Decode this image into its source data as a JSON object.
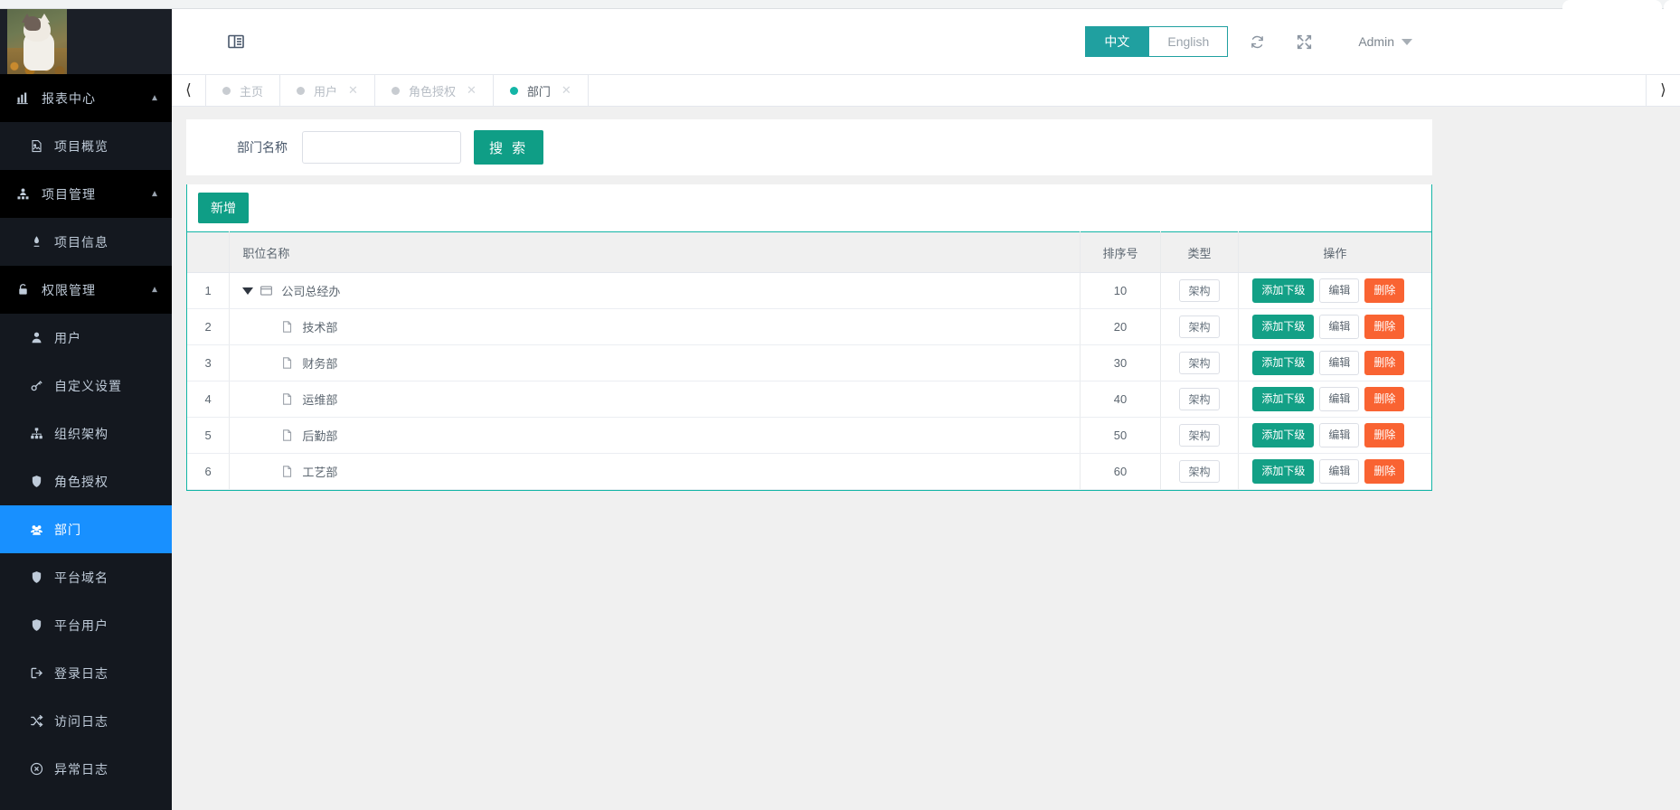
{
  "header": {
    "hamburger_icon": "collapse-menu-icon",
    "lang_active": "中文",
    "lang_inactive": "English",
    "refresh_icon": "refresh-icon",
    "fullscreen_icon": "fullscreen-icon",
    "user_name": "Admin",
    "accent_teal": "#20a0a0"
  },
  "sidebar": {
    "avatar_name": "cat-avatar-photo",
    "groups": [
      {
        "label": "报表中心",
        "icon": "bar-chart-icon",
        "expanded": true,
        "items": [
          {
            "label": "项目概览",
            "icon": "image-file-icon",
            "active": false
          }
        ]
      },
      {
        "label": "项目管理",
        "icon": "project-user-icon",
        "expanded": true,
        "items": [
          {
            "label": "项目信息",
            "icon": "pen-icon",
            "active": false
          }
        ]
      },
      {
        "label": "权限管理",
        "icon": "lock-icon",
        "expanded": true,
        "items": [
          {
            "label": "用户",
            "icon": "user-icon",
            "active": false
          },
          {
            "label": "自定义设置",
            "icon": "key-icon",
            "active": false
          },
          {
            "label": "组织架构",
            "icon": "sitemap-icon",
            "active": false
          },
          {
            "label": "角色授权",
            "icon": "shield-icon",
            "active": false
          },
          {
            "label": "部门",
            "icon": "users-group-icon",
            "active": true
          },
          {
            "label": "平台域名",
            "icon": "shield-icon",
            "active": false
          },
          {
            "label": "平台用户",
            "icon": "shield-icon",
            "active": false
          },
          {
            "label": "登录日志",
            "icon": "sign-in-icon",
            "active": false
          },
          {
            "label": "访问日志",
            "icon": "shuffle-icon",
            "active": false
          },
          {
            "label": "异常日志",
            "icon": "error-circle-icon",
            "active": false
          }
        ]
      }
    ],
    "active_color": "#1890ff",
    "bg_color": "#14181f"
  },
  "tabs": {
    "prev_icon": "chevron-left-icon",
    "next_icon": "chevron-right-icon",
    "items": [
      {
        "label": "主页",
        "closable": false,
        "active": false
      },
      {
        "label": "用户",
        "closable": true,
        "active": false
      },
      {
        "label": "角色授权",
        "closable": true,
        "active": false
      },
      {
        "label": "部门",
        "closable": true,
        "active": true
      }
    ]
  },
  "search": {
    "label": "部门名称",
    "value": "",
    "placeholder": "",
    "button": "搜 索"
  },
  "toolbar": {
    "add_label": "新增"
  },
  "table": {
    "columns": [
      {
        "key": "index",
        "label": ""
      },
      {
        "key": "name",
        "label": "职位名称"
      },
      {
        "key": "sort",
        "label": "排序号"
      },
      {
        "key": "type",
        "label": "类型"
      },
      {
        "key": "op",
        "label": "操作"
      }
    ],
    "row_actions": {
      "add_child": "添加下级",
      "edit": "编辑",
      "delete": "删除"
    },
    "rows": [
      {
        "index": "1",
        "name": "公司总经办",
        "sort": "10",
        "type": "架构",
        "level": 0,
        "expanded": true,
        "icon": "folder-open-icon"
      },
      {
        "index": "2",
        "name": "技术部",
        "sort": "20",
        "type": "架构",
        "level": 1,
        "expanded": false,
        "icon": "file-icon"
      },
      {
        "index": "3",
        "name": "财务部",
        "sort": "30",
        "type": "架构",
        "level": 1,
        "expanded": false,
        "icon": "file-icon"
      },
      {
        "index": "4",
        "name": "运维部",
        "sort": "40",
        "type": "架构",
        "level": 1,
        "expanded": false,
        "icon": "file-icon"
      },
      {
        "index": "5",
        "name": "后勤部",
        "sort": "50",
        "type": "架构",
        "level": 1,
        "expanded": false,
        "icon": "file-icon"
      },
      {
        "index": "6",
        "name": "工艺部",
        "sort": "60",
        "type": "架构",
        "level": 1,
        "expanded": false,
        "icon": "file-icon"
      }
    ]
  },
  "colors": {
    "primary_teal": "#13b5a6",
    "button_green": "#0f9e86",
    "button_red": "#f96332",
    "sidebar_active_blue": "#1890ff"
  }
}
